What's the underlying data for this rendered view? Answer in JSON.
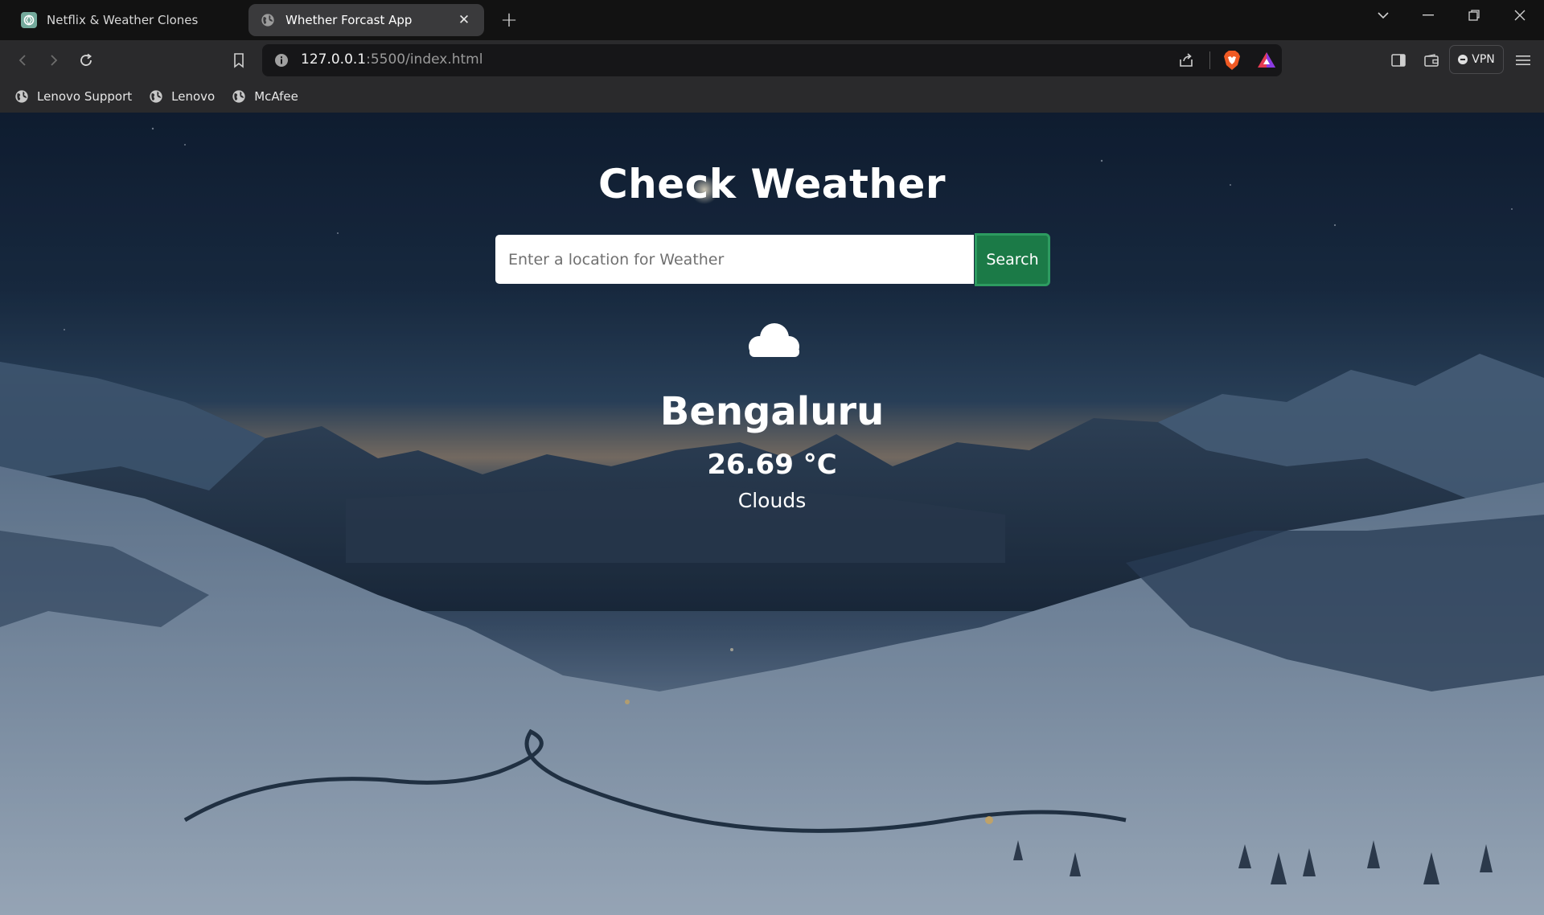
{
  "browser": {
    "tabs": [
      {
        "label": "Netflix & Weather Clones",
        "icon": "chatgpt-icon",
        "active": false
      },
      {
        "label": "Whether Forcast App",
        "icon": "globe-icon",
        "active": true
      }
    ],
    "new_tab_label": "+",
    "url_host": "127.0.0.1",
    "url_rest": ":5500/index.html",
    "vpn_label": "VPN",
    "bookmarks": [
      {
        "label": "Lenovo Support",
        "icon": "globe-icon"
      },
      {
        "label": "Lenovo",
        "icon": "globe-icon"
      },
      {
        "label": "McAfee",
        "icon": "globe-icon"
      }
    ]
  },
  "app": {
    "title": "Check Weather",
    "search": {
      "placeholder": "Enter a location for Weather",
      "value": "",
      "button_label": "Search"
    },
    "weather": {
      "icon": "cloud-icon",
      "city": "Bengaluru",
      "temperature": "26.69 °C",
      "condition": "Clouds"
    }
  },
  "colors": {
    "search_button": "#1b7a47",
    "search_button_border": "#2d9b60",
    "chrome_dark": "#121212",
    "toolbar": "#2a2a2c"
  }
}
